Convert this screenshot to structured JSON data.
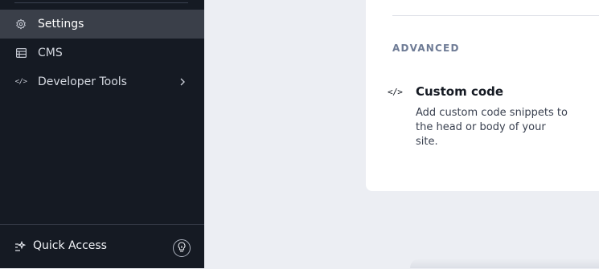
{
  "sidebar": {
    "items": [
      {
        "label": "Settings",
        "icon": "gear-icon",
        "active": true
      },
      {
        "label": "CMS",
        "icon": "table-icon"
      },
      {
        "label": "Developer Tools",
        "icon": "code-icon",
        "code_glyph": "</>",
        "has_submenu": true
      }
    ],
    "quick_access": {
      "label": "Quick Access",
      "icon": "sparkle-list-icon"
    },
    "help_icon": "lightbulb-icon"
  },
  "main": {
    "section_title": "ADVANCED",
    "custom_code": {
      "icon_glyph": "</>",
      "title": "Custom code",
      "description": "Add custom code snippets to the head or body of your site."
    }
  },
  "colors": {
    "sidebar_bg": "#151a23",
    "sidebar_active": "#3a3f49",
    "page_bg": "#eceef3",
    "card_bg": "#ffffff",
    "section_title": "#6e7b95"
  }
}
